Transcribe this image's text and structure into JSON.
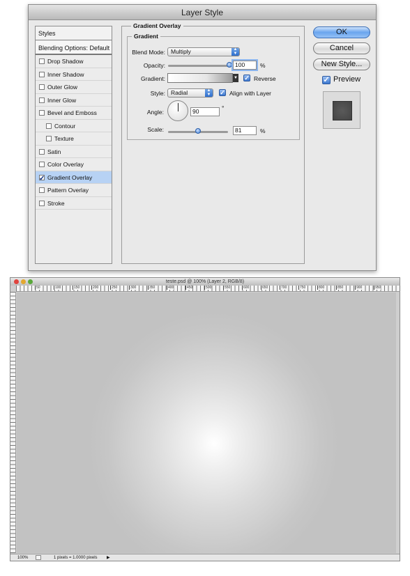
{
  "dialog": {
    "title": "Layer Style",
    "styles_header": "Styles",
    "blending_options": "Blending Options: Default",
    "effects": [
      {
        "label": "Drop Shadow",
        "checked": false,
        "sub": false,
        "selected": false
      },
      {
        "label": "Inner Shadow",
        "checked": false,
        "sub": false,
        "selected": false
      },
      {
        "label": "Outer Glow",
        "checked": false,
        "sub": false,
        "selected": false
      },
      {
        "label": "Inner Glow",
        "checked": false,
        "sub": false,
        "selected": false
      },
      {
        "label": "Bevel and Emboss",
        "checked": false,
        "sub": false,
        "selected": false
      },
      {
        "label": "Contour",
        "checked": false,
        "sub": true,
        "selected": false
      },
      {
        "label": "Texture",
        "checked": false,
        "sub": true,
        "selected": false
      },
      {
        "label": "Satin",
        "checked": false,
        "sub": false,
        "selected": false
      },
      {
        "label": "Color Overlay",
        "checked": false,
        "sub": false,
        "selected": false
      },
      {
        "label": "Gradient Overlay",
        "checked": true,
        "sub": false,
        "selected": true
      },
      {
        "label": "Pattern Overlay",
        "checked": false,
        "sub": false,
        "selected": false
      },
      {
        "label": "Stroke",
        "checked": false,
        "sub": false,
        "selected": false
      }
    ],
    "panel": {
      "group_title": "Gradient Overlay",
      "subgroup_title": "Gradient",
      "blend_mode_label": "Blend Mode:",
      "blend_mode_value": "Multiply",
      "opacity_label": "Opacity:",
      "opacity_value": "100",
      "opacity_fraction": 1.0,
      "percent": "%",
      "gradient_label": "Gradient:",
      "reverse_label": "Reverse",
      "reverse_checked": true,
      "style_label": "Style:",
      "style_value": "Radial",
      "align_label": "Align with Layer",
      "align_checked": true,
      "angle_label": "Angle:",
      "angle_value": "90",
      "degree": "°",
      "scale_label": "Scale:",
      "scale_value": "81",
      "scale_fraction": 0.5
    },
    "buttons": {
      "ok": "OK",
      "cancel": "Cancel",
      "new_style": "New Style..."
    },
    "preview_label": "Preview",
    "preview_checked": true
  },
  "document": {
    "title": "teste.psd @ 100% (Layer 2, RGB/8)",
    "ruler_ticks": [
      "50",
      "100",
      "150",
      "200",
      "250",
      "300",
      "350",
      "400",
      "450",
      "500",
      "550",
      "600",
      "650",
      "700",
      "750",
      "800",
      "850",
      "900",
      "950"
    ],
    "zoom": "100%",
    "status_info": "1 pixels = 1.0000 pixels"
  },
  "colors": {
    "accent_blue": "#3a76cf",
    "selection": "#b7d2f4",
    "canvas_edge": "#c2c2c2",
    "canvas_center": "#ffffff"
  }
}
